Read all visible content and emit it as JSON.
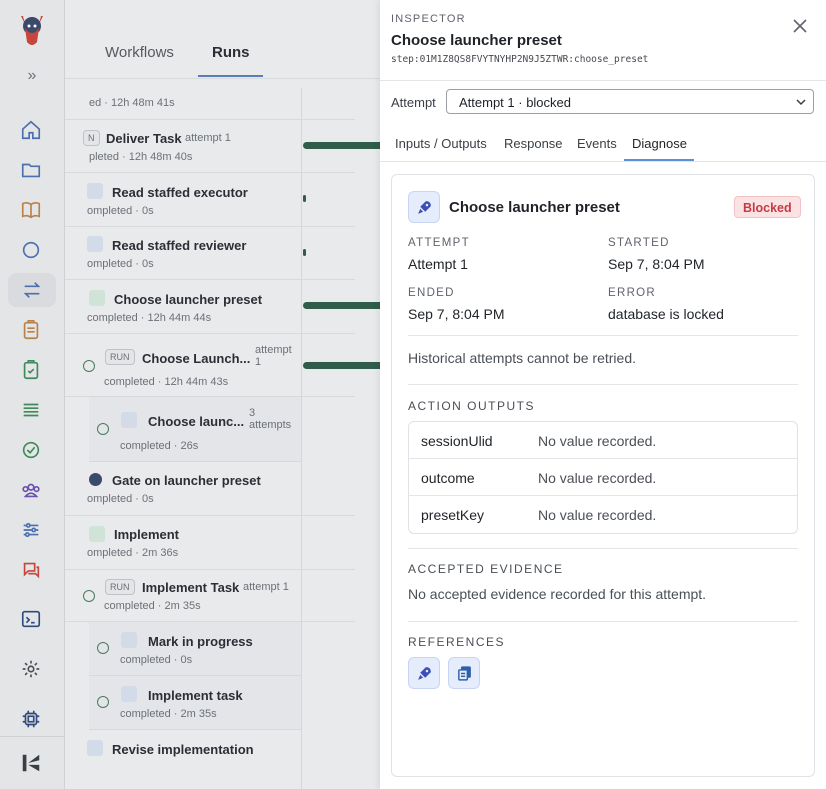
{
  "colors": {
    "accent": "#5b8fd8",
    "blocked_text": "#c33b46",
    "blocked_bg": "#fbe3e4",
    "bar_green": "#2f5d4a",
    "icon_bg": "#e5ecfb"
  },
  "rail": {
    "icons": [
      "logo-icon",
      "collapse-icon",
      "home-icon",
      "folder-icon",
      "book-icon",
      "chat-icon",
      "transfer-icon",
      "clipboard-icon",
      "clipboard-check-icon",
      "list-icon",
      "check-circle-icon",
      "team-icon",
      "sliders-icon",
      "feedback-icon",
      "terminal-icon",
      "gear-icon",
      "chip-icon",
      "brand-icon"
    ]
  },
  "main": {
    "tabs": [
      "Workflows",
      "Runs"
    ],
    "rows": [
      {
        "title": "",
        "sub": "ed · 12h 48m 41s"
      },
      {
        "title": "Deliver Task",
        "meta": "attempt 1",
        "badge": "N",
        "sub": "pleted · 12h 48m 40s"
      },
      {
        "title": "Read staffed executor",
        "sub": "ompleted · 0s"
      },
      {
        "title": "Read staffed reviewer",
        "sub": "ompleted · 0s"
      },
      {
        "title": "Choose launcher preset",
        "sub": "completed · 12h 44m 44s"
      },
      {
        "title": "Choose Launch...",
        "badge": "RUN",
        "meta": "attempt 1",
        "sub": "completed · 12h 44m 43s"
      },
      {
        "title": "Choose launc...",
        "meta": "3 attempts",
        "sub": "completed · 26s"
      },
      {
        "title": "Gate on launcher preset",
        "sub": "ompleted · 0s"
      },
      {
        "title": "Implement",
        "sub": "ompleted · 2m 36s"
      },
      {
        "title": "Implement Task",
        "badge": "RUN",
        "meta": "attempt 1",
        "sub": "completed · 2m 35s"
      },
      {
        "title": "Mark in progress",
        "sub": "completed · 0s"
      },
      {
        "title": "Implement task",
        "sub": "completed · 2m 35s"
      },
      {
        "title": "Revise implementation",
        "sub": ""
      }
    ]
  },
  "inspector": {
    "eyebrow": "INSPECTOR",
    "title": "Choose launcher preset",
    "step": "step:01M1Z8QS8FVYTNYHP2N9J5ZTWR:choose_preset",
    "attempt_label": "Attempt",
    "attempt_value": "Attempt 1 · blocked",
    "tabs": [
      "Inputs / Outputs",
      "Response",
      "Events",
      "Diagnose"
    ],
    "active_tab": "Diagnose",
    "card": {
      "title": "Choose launcher preset",
      "status": "Blocked",
      "attempt_label": "ATTEMPT",
      "attempt_value": "Attempt 1",
      "started_label": "STARTED",
      "started_value": "Sep 7, 8:04 PM",
      "ended_label": "ENDED",
      "ended_value": "Sep 7, 8:04 PM",
      "error_label": "ERROR",
      "error_value": "database is locked",
      "note": "Historical attempts cannot be retried.",
      "outputs_heading": "ACTION OUTPUTS",
      "outputs": [
        {
          "key": "sessionUlid",
          "value": "No value recorded."
        },
        {
          "key": "outcome",
          "value": "No value recorded."
        },
        {
          "key": "presetKey",
          "value": "No value recorded."
        }
      ],
      "evidence_heading": "ACCEPTED EVIDENCE",
      "evidence_text": "No accepted evidence recorded for this attempt.",
      "references_heading": "REFERENCES",
      "references": [
        "rocket-icon",
        "documents-icon"
      ]
    }
  }
}
